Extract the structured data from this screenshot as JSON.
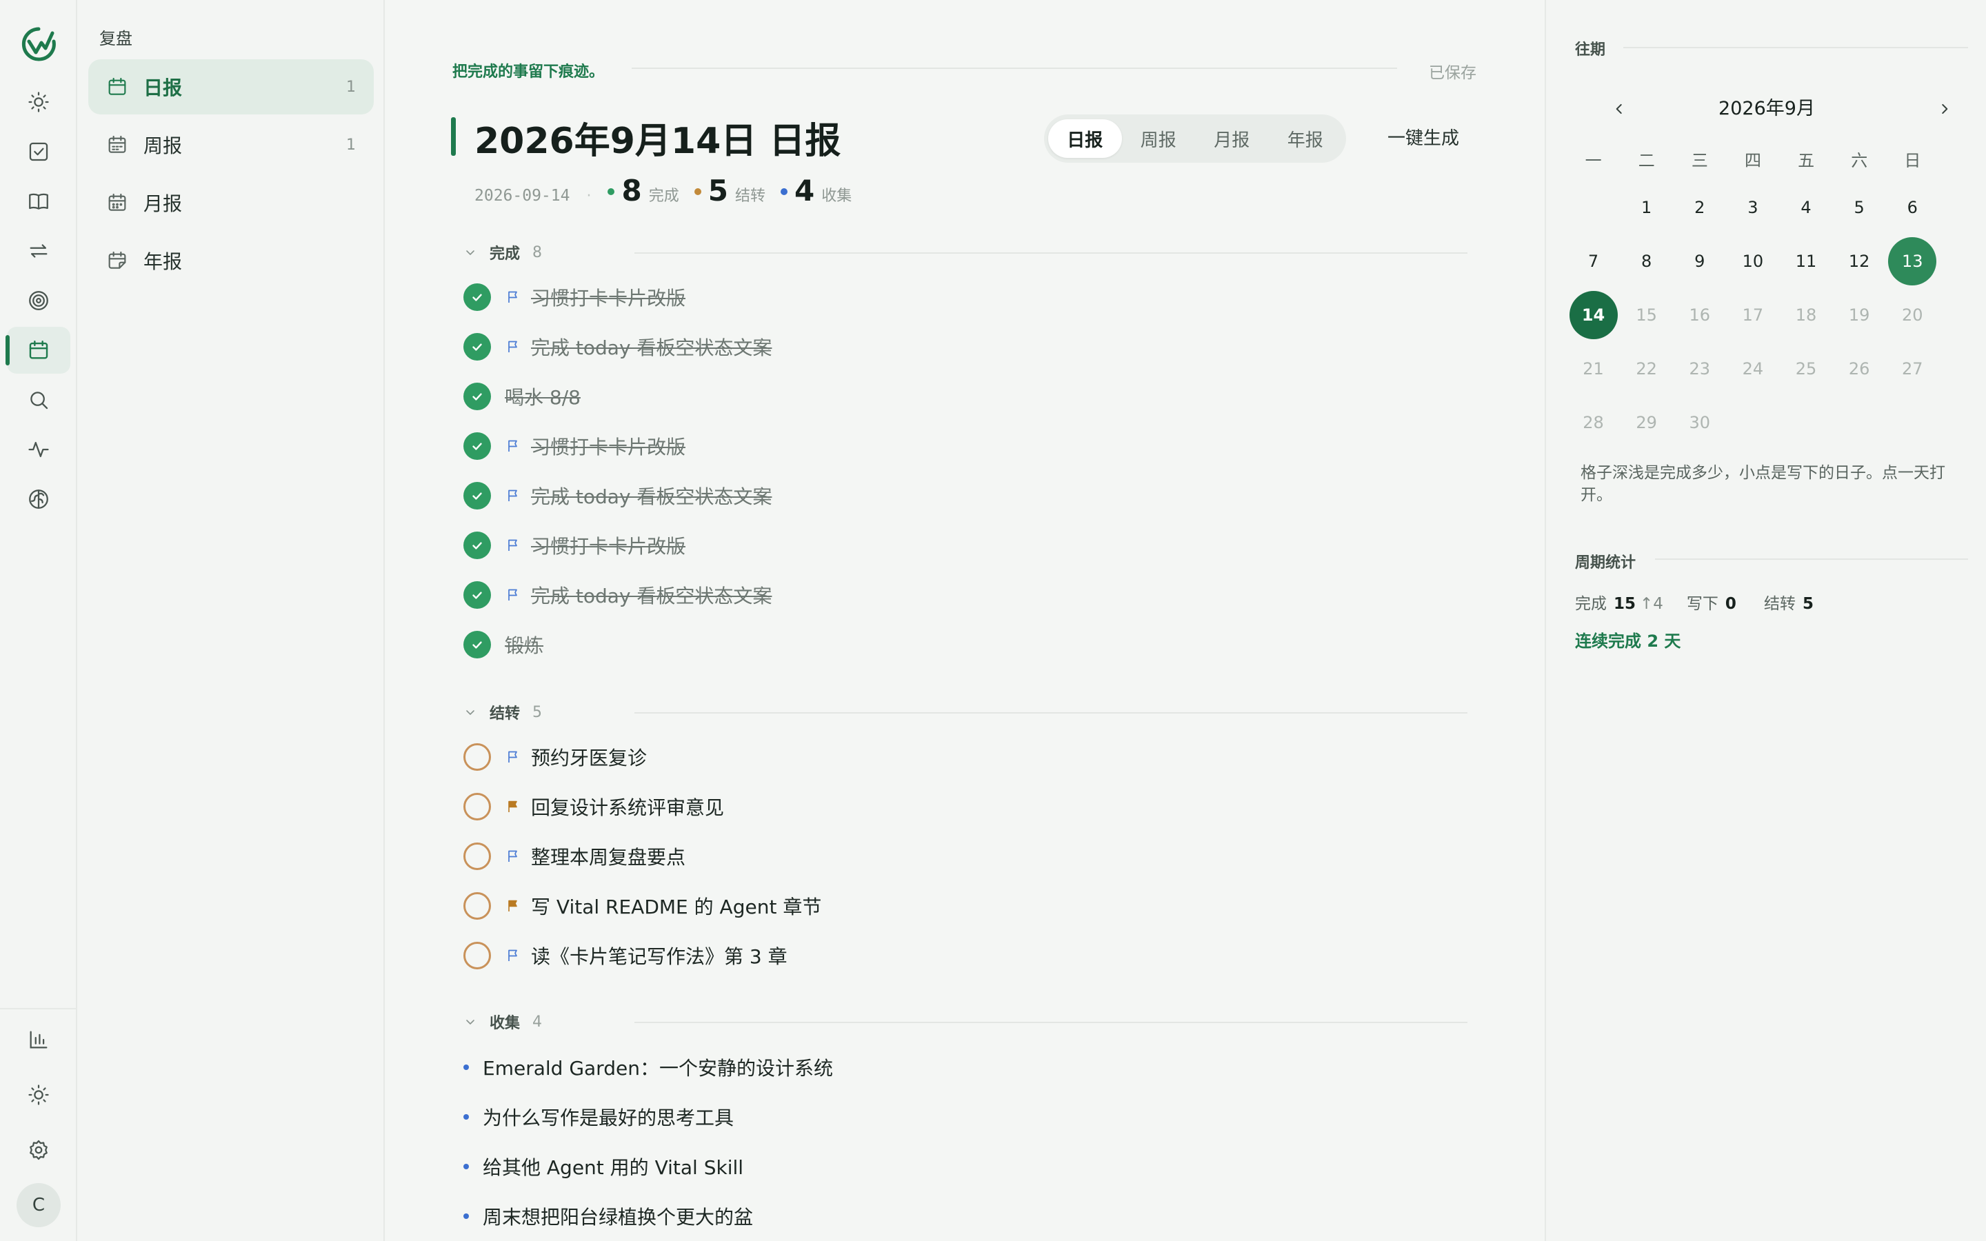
{
  "rail": {
    "items": [
      {
        "name": "today-icon"
      },
      {
        "name": "tasks-icon"
      },
      {
        "name": "notes-icon"
      },
      {
        "name": "habits-icon"
      },
      {
        "name": "goals-icon"
      },
      {
        "name": "review-icon",
        "active": true
      },
      {
        "name": "search-icon"
      },
      {
        "name": "activity-icon"
      },
      {
        "name": "brain-icon"
      }
    ],
    "bottom": [
      {
        "name": "stats-icon"
      },
      {
        "name": "theme-icon"
      },
      {
        "name": "settings-icon"
      }
    ],
    "avatar": "C"
  },
  "nav": {
    "section": "复盘",
    "items": [
      {
        "label": "日报",
        "count": "1",
        "active": true
      },
      {
        "label": "周报",
        "count": "1"
      },
      {
        "label": "月报",
        "count": ""
      },
      {
        "label": "年报",
        "count": ""
      }
    ]
  },
  "main": {
    "tagline": "把完成的事留下痕迹。",
    "saved": "已保存",
    "title": "2026年9月14日 日报",
    "tabs": [
      "日报",
      "周报",
      "月报",
      "年报"
    ],
    "generate": "一键生成",
    "date": "2026-09-14",
    "stats": [
      {
        "num": "8",
        "label": "完成",
        "color": "#2f9c62"
      },
      {
        "num": "5",
        "label": "结转",
        "color": "#c28a3a"
      },
      {
        "num": "4",
        "label": "收集",
        "color": "#3b6fd0"
      }
    ],
    "groups": {
      "done": {
        "title": "完成",
        "count": "8",
        "tasks": [
          {
            "text": "习惯打卡卡片改版",
            "flag": "blue"
          },
          {
            "text": "完成 today 看板空状态文案",
            "flag": "blue"
          },
          {
            "text": "喝水 8/8",
            "flag": "none"
          },
          {
            "text": "习惯打卡卡片改版",
            "flag": "blue"
          },
          {
            "text": "完成 today 看板空状态文案",
            "flag": "blue"
          },
          {
            "text": "习惯打卡卡片改版",
            "flag": "blue"
          },
          {
            "text": "完成 today 看板空状态文案",
            "flag": "blue"
          },
          {
            "text": "锻炼",
            "flag": "none"
          }
        ]
      },
      "carry": {
        "title": "结转",
        "count": "5",
        "tasks": [
          {
            "text": "预约牙医复诊",
            "flag": "blue"
          },
          {
            "text": "回复设计系统评审意见",
            "flag": "orange"
          },
          {
            "text": "整理本周复盘要点",
            "flag": "blue"
          },
          {
            "text": "写 Vital README 的 Agent 章节",
            "flag": "orange"
          },
          {
            "text": "读《卡片笔记写作法》第 3 章",
            "flag": "blue"
          }
        ]
      },
      "collect": {
        "title": "收集",
        "count": "4",
        "items": [
          "Emerald Garden：一个安静的设计系统",
          "为什么写作是最好的思考工具",
          "给其他 Agent 用的 Vital Skill",
          "周末想把阳台绿植换个更大的盆"
        ]
      }
    }
  },
  "right": {
    "history_title": "往期",
    "month": "2026年9月",
    "weekdays": [
      "一",
      "二",
      "三",
      "四",
      "五",
      "六",
      "日"
    ],
    "weeks": [
      [
        "",
        "1",
        "2",
        "3",
        "4",
        "5",
        "6"
      ],
      [
        "7",
        "8",
        "9",
        "10",
        "11",
        "12",
        "13"
      ],
      [
        "14",
        "15",
        "16",
        "17",
        "18",
        "19",
        "20"
      ],
      [
        "21",
        "22",
        "23",
        "24",
        "25",
        "26",
        "27"
      ],
      [
        "28",
        "29",
        "30",
        "",
        "",
        "",
        ""
      ]
    ],
    "selected_day": "13",
    "today_day": "14",
    "help": "格子深浅是完成多少，小点是写下的日子。点一天打开。",
    "period_title": "周期统计",
    "period": {
      "done_label": "完成",
      "done_value": "15",
      "done_delta": "↑4",
      "written_label": "写下",
      "written_value": "0",
      "carry_label": "结转",
      "carry_value": "5"
    },
    "streak": "连续完成 2 天"
  },
  "colors": {
    "accent": "#1e7a4d",
    "done": "#2f9c62",
    "carry": "#c9925a",
    "collect": "#3b6fd0"
  }
}
